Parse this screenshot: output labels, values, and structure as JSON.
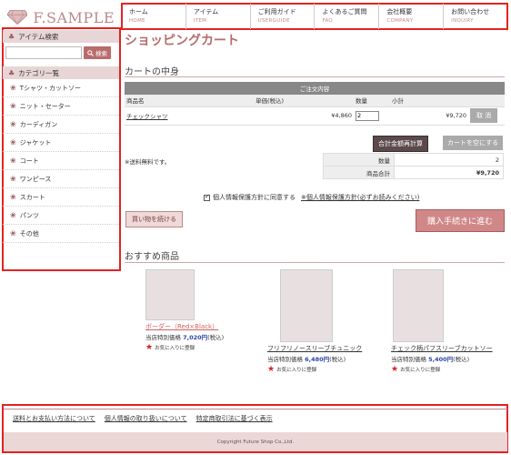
{
  "header": {
    "logo_text": "F.SAMPLE",
    "nav": [
      {
        "jp": "ホーム",
        "en": "HOME"
      },
      {
        "jp": "アイテム",
        "en": "ITEM"
      },
      {
        "jp": "ご利用ガイド",
        "en": "USERGUIDE"
      },
      {
        "jp": "よくあるご質問",
        "en": "FAQ"
      },
      {
        "jp": "会社概要",
        "en": "COMPANY"
      },
      {
        "jp": "お問い合わせ",
        "en": "INQUIRY"
      }
    ]
  },
  "sidebar": {
    "search_heading": "アイテム検索",
    "search_button": "検索",
    "search_placeholder": "",
    "category_heading": "カテゴリ一覧",
    "categories": [
      "Tシャツ・カットソー",
      "ニット・セーター",
      "カーディガン",
      "ジャケット",
      "コート",
      "ワンピース",
      "スカート",
      "パンツ",
      "その他"
    ]
  },
  "main": {
    "page_title": "ショッピングカート",
    "cart_heading": "カートの中身",
    "table_caption": "ご注文内容",
    "col_name": "商品名",
    "col_unit_price": "単価(税込)",
    "col_qty": "数量",
    "col_subtotal": "小計",
    "row": {
      "name": "チェックシャツ",
      "unit_price": "¥4,860",
      "qty": "2",
      "subtotal": "¥9,720",
      "delete": "取 消"
    },
    "recalc_button": "合計金額再計算",
    "empty_button": "カートを空にする",
    "shipping_note": "※送料無料です。",
    "sum_qty_label": "数量",
    "sum_qty_value": "2",
    "sum_total_label": "商品合計",
    "sum_total_value": "¥9,720",
    "privacy_agree": "個人情報保護方針に同意する",
    "privacy_link": "※個人情報保護方針(必ずお読みください)",
    "continue_button": "買い物を続ける",
    "checkout_button": "購入手続きに進む"
  },
  "recommend": {
    "heading": "おすすめ商品",
    "products": [
      {
        "name": "ボーダー（Red×Black）",
        "price_label": "当店特別価格",
        "price": "7,020円",
        "tax": "(税込)",
        "fav": "お気に入りに登録"
      },
      {
        "name": "フリフリノースリーブチュニック",
        "price_label": "当店特別価格",
        "price": "6,480円",
        "tax": "(税込)",
        "fav": "お気に入りに登録"
      },
      {
        "name": "チェック柄パフスリーブカットソー",
        "price_label": "当店特別価格",
        "price": "5,400円",
        "tax": "(税込)",
        "fav": "お気に入りに登録"
      }
    ]
  },
  "footer": {
    "links": [
      "送料とお支払い方法について",
      "個人情報の取り扱いについて",
      "特定商取引法に基づく表示"
    ],
    "copyright": "Copyright Future Shop Co.,Ltd."
  },
  "colors": {
    "accent": "#b86c6c",
    "highlight_frame": "#e32222",
    "price_blue": "#2a46a8"
  }
}
